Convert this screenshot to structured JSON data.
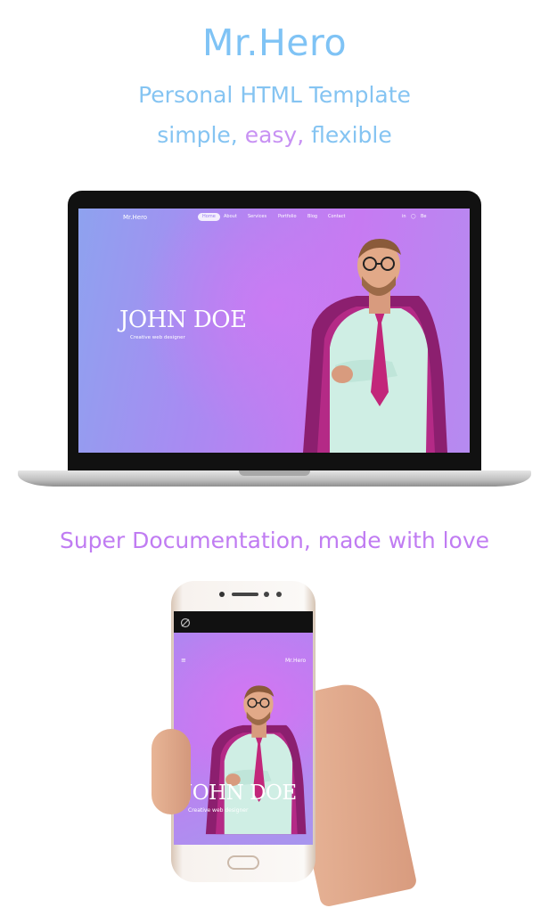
{
  "header": {
    "title": "Mr.Hero",
    "subtitle": "Personal HTML Template",
    "tagline": {
      "word1": "simple,",
      "word2": "easy,",
      "word3": "flexible"
    }
  },
  "laptop_site": {
    "logo": "Mr.Hero",
    "nav": [
      "Home",
      "About",
      "Services",
      "Portfolio",
      "Blog",
      "Contact"
    ],
    "social": [
      "in",
      "◯",
      "Be"
    ],
    "hero_name": "JOHN DOE",
    "hero_role": "Creative web designer"
  },
  "doc_heading": "Super Documentation, made with love",
  "phone_site": {
    "menu_icon": "≡",
    "logo": "Mr.Hero",
    "hero_name": "JOHN DOE",
    "hero_role": "Creative web designer"
  },
  "icons": {
    "menu": "menu-icon",
    "status": "no-signal-icon"
  },
  "colors": {
    "title_blue": "#7fc3f5",
    "accent_purple": "#c892f3",
    "hero_gradient_start": "#8ea2ef",
    "hero_gradient_end": "#c67af2",
    "tie": "#c2267a",
    "shirt": "#cfeee4"
  }
}
